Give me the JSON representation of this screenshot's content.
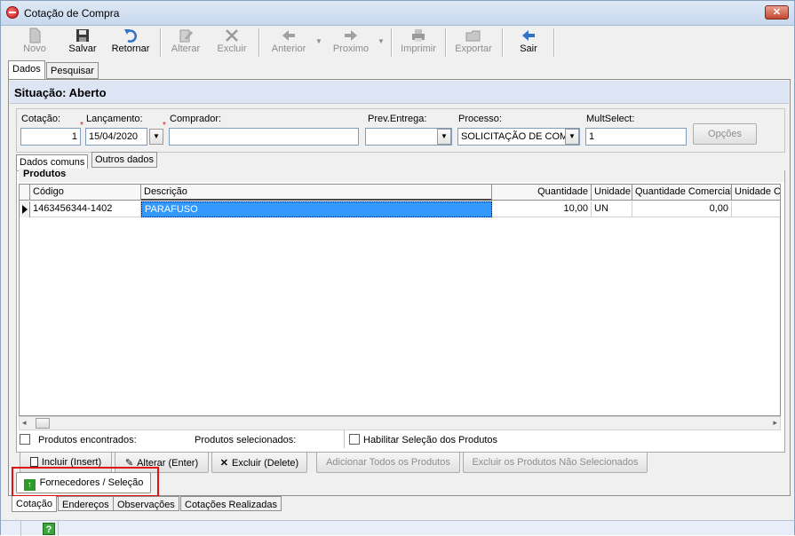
{
  "window": {
    "title": "Cotação de Compra",
    "close_label": "✕"
  },
  "toolbar": {
    "novo": "Novo",
    "salvar": "Salvar",
    "retornar": "Retornar",
    "alterar": "Alterar",
    "excluir": "Excluir",
    "anterior": "Anterior",
    "proximo": "Proximo",
    "imprimir": "Imprimir",
    "exportar": "Exportar",
    "sair": "Sair"
  },
  "top_tabs": [
    "Dados",
    "Pesquisar"
  ],
  "situacao": "Situação: Aberto",
  "form": {
    "cotacao_label": "Cotação:",
    "cotacao_value": "1",
    "lancamento_label": "Lançamento:",
    "lancamento_value": "15/04/2020",
    "comprador_label": "Comprador:",
    "comprador_value": "",
    "preventrega_label": "Prev.Entrega:",
    "preventrega_value": "",
    "processo_label": "Processo:",
    "processo_value": "SOLICITAÇÃO DE COM",
    "multselect_label": "MultSelect:",
    "multselect_value": "1",
    "opcoes_button": "Opções"
  },
  "sub_tabs": [
    "Dados comuns",
    "Outros dados"
  ],
  "produtos": {
    "title": "Produtos",
    "columns": [
      "Código",
      "Descrição",
      "Quantidade",
      "Unidade",
      "Quantidade Comercial",
      "Unidade C"
    ],
    "rows": [
      {
        "codigo": "1463456344-1402",
        "descricao": "PARAFUSO",
        "quantidade": "10,00",
        "unidade": "UN",
        "qtd_comercial": "0,00",
        "unidade_c": ""
      }
    ],
    "encontrados_label": "Produtos encontrados:",
    "selecionados_label": "Produtos selecionados:",
    "habilitar_label": "Habilitar Seleção dos Produtos"
  },
  "actions": {
    "incluir": "Incluir (Insert)",
    "alterar": "Alterar (Enter)",
    "excluir": "Excluir (Delete)",
    "adicionar_todos": "Adicionar Todos os Produtos",
    "excluir_nao_sel": "Excluir os Produtos Não Selecionados"
  },
  "fornecedores_tab": "Fornecedores / Seleção",
  "bottom_tabs": [
    "Cotação",
    "Endereços",
    "Observações",
    "Cotações Realizadas"
  ],
  "status_bar": {
    "help_icon": "?"
  },
  "colors": {
    "highlight_red": "#e01010",
    "selection_blue": "#3399ff",
    "situacao_bg": "#dde4f3"
  }
}
